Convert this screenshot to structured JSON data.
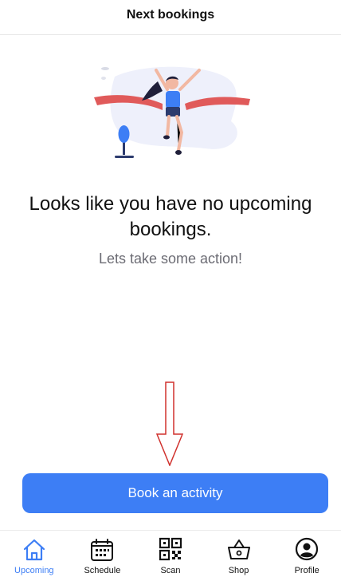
{
  "header": {
    "title": "Next bookings"
  },
  "empty_state": {
    "illustration_icon": "finish-line-runner-illustration",
    "title": "Looks like you have no upcoming bookings.",
    "subtitle": "Lets take some action!"
  },
  "annotation": {
    "icon": "red-outline-down-arrow",
    "color": "#d0312d"
  },
  "cta": {
    "label": "Book an activity",
    "color": "#3d7ef5"
  },
  "tabbar": {
    "active_color": "#3d7ef5",
    "items": [
      {
        "label": "Upcoming",
        "icon": "home-icon",
        "active": true
      },
      {
        "label": "Schedule",
        "icon": "calendar-icon",
        "active": false
      },
      {
        "label": "Scan",
        "icon": "qr-code-icon",
        "active": false
      },
      {
        "label": "Shop",
        "icon": "shopping-basket-icon",
        "active": false
      },
      {
        "label": "Profile",
        "icon": "profile-icon",
        "active": false
      }
    ]
  }
}
